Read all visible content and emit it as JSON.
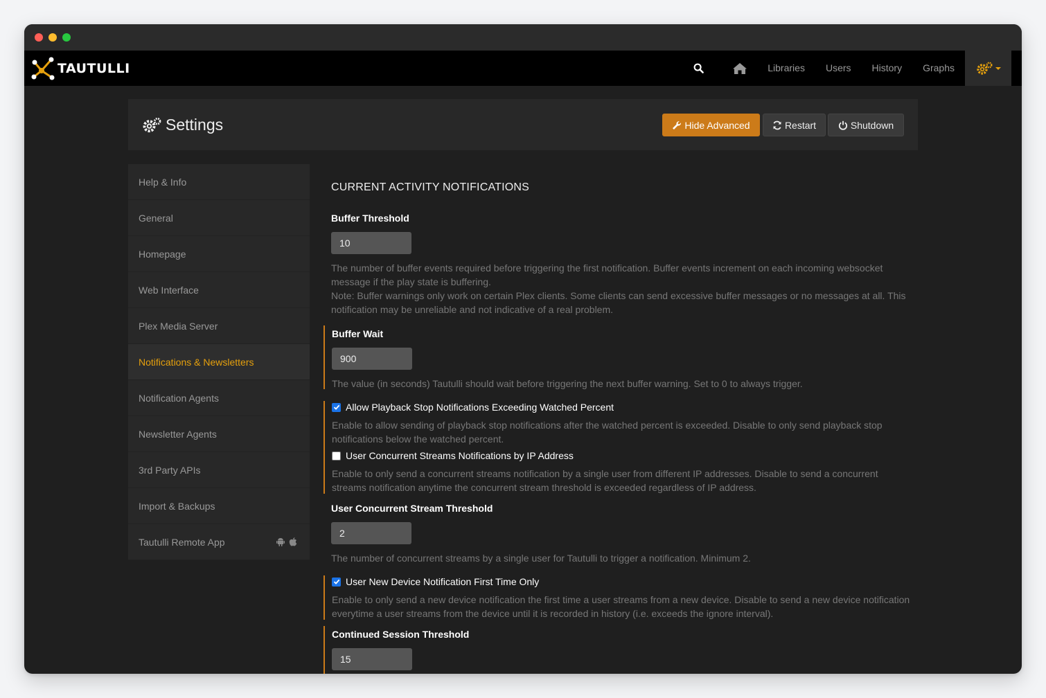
{
  "app": {
    "brand": "TAUTULLI"
  },
  "nav": {
    "links": [
      "Libraries",
      "Users",
      "History",
      "Graphs"
    ]
  },
  "header": {
    "title": "Settings",
    "buttons": {
      "hide_advanced": "Hide Advanced",
      "restart": "Restart",
      "shutdown": "Shutdown"
    }
  },
  "sidebar": {
    "items": [
      {
        "label": "Help & Info",
        "active": false
      },
      {
        "label": "General",
        "active": false
      },
      {
        "label": "Homepage",
        "active": false
      },
      {
        "label": "Web Interface",
        "active": false
      },
      {
        "label": "Plex Media Server",
        "active": false
      },
      {
        "label": "Notifications & Newsletters",
        "active": true
      },
      {
        "label": "Notification Agents",
        "active": false
      },
      {
        "label": "Newsletter Agents",
        "active": false
      },
      {
        "label": "3rd Party APIs",
        "active": false
      },
      {
        "label": "Import & Backups",
        "active": false
      },
      {
        "label": "Tautulli Remote App",
        "active": false
      }
    ]
  },
  "main": {
    "section_title": "CURRENT ACTIVITY NOTIFICATIONS",
    "buffer_threshold": {
      "label": "Buffer Threshold",
      "value": "10",
      "help1": "The number of buffer events required before triggering the first notification. Buffer events increment on each incoming websocket message if the play state is buffering.",
      "help2": "Note: Buffer warnings only work on certain Plex clients. Some clients can send excessive buffer messages or no messages at all. This notification may be unreliable and not indicative of a real problem."
    },
    "buffer_wait": {
      "label": "Buffer Wait",
      "value": "900",
      "help": "The value (in seconds) Tautulli should wait before triggering the next buffer warning. Set to 0 to always trigger."
    },
    "playback_stop": {
      "label": "Allow Playback Stop Notifications Exceeding Watched Percent",
      "checked": true,
      "help": "Enable to allow sending of playback stop notifications after the watched percent is exceeded. Disable to only send playback stop notifications below the watched percent."
    },
    "concurrent_ip": {
      "label": "User Concurrent Streams Notifications by IP Address",
      "checked": false,
      "help": "Enable to only send a concurrent streams notification by a single user from different IP addresses. Disable to send a concurrent streams notification anytime the concurrent stream threshold is exceeded regardless of IP address."
    },
    "concurrent_threshold": {
      "label": "User Concurrent Stream Threshold",
      "value": "2",
      "help": "The number of concurrent streams by a single user for Tautulli to trigger a notification. Minimum 2."
    },
    "new_device": {
      "label": "User New Device Notification First Time Only",
      "checked": true,
      "help": "Enable to only send a new device notification the first time a user streams from a new device. Disable to send a new device notification everytime a user streams from the device until it is recorded in history (i.e. exceeds the ignore interval)."
    },
    "continued_session": {
      "label": "Continued Session Threshold",
      "value": "15"
    }
  },
  "colors": {
    "accent": "#e5a00d",
    "button_orange": "#cc7b19",
    "checkbox_blue": "#1a73e8"
  }
}
